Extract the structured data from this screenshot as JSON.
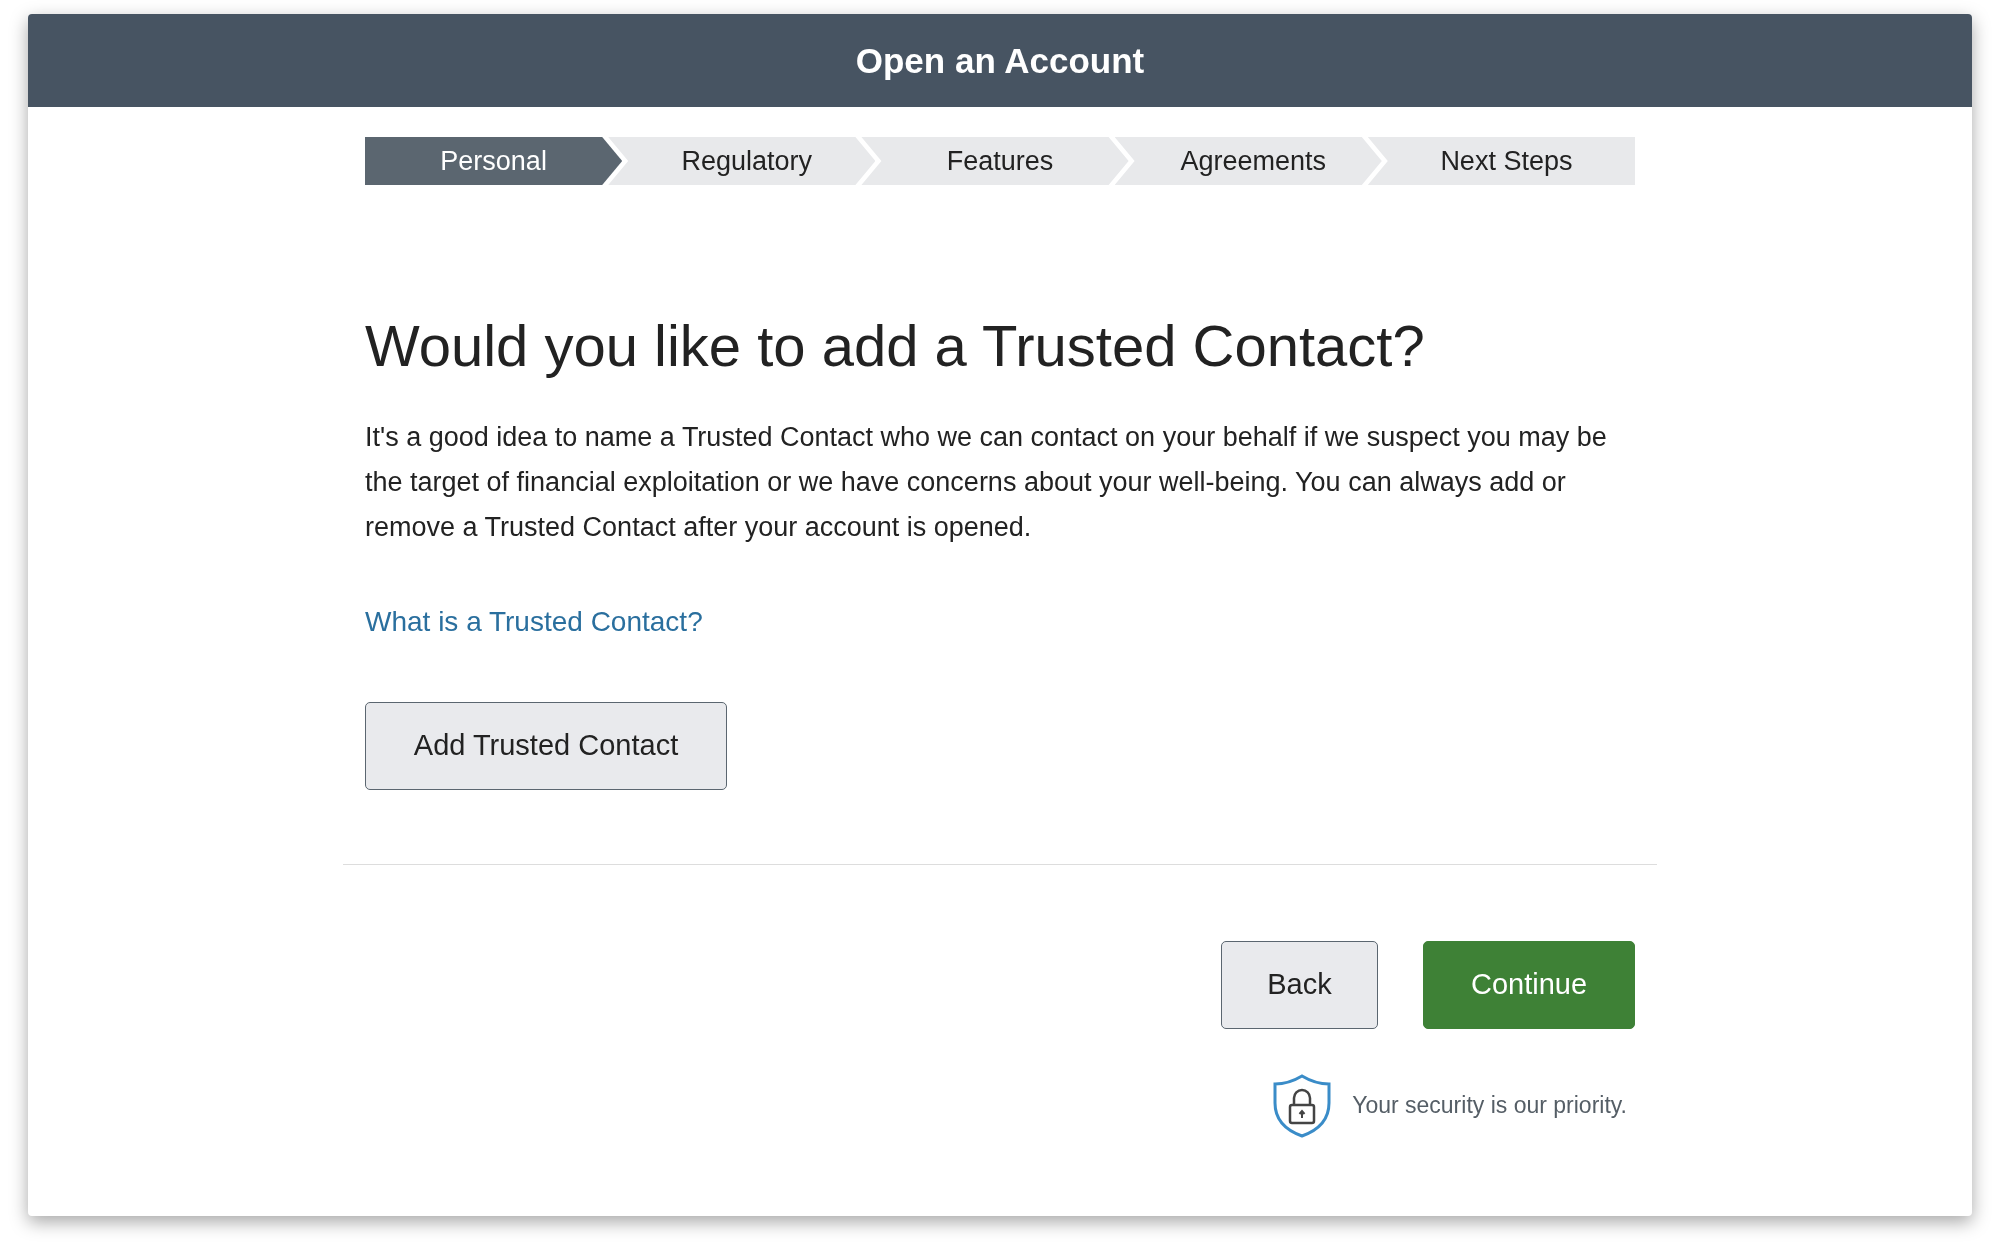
{
  "window": {
    "title": "Open an Account"
  },
  "steps": [
    {
      "label": "Personal",
      "selected": true
    },
    {
      "label": "Regulatory",
      "selected": false
    },
    {
      "label": "Features",
      "selected": false
    },
    {
      "label": "Agreements",
      "selected": false
    },
    {
      "label": "Next Steps",
      "selected": false
    }
  ],
  "heading": "Would you like to add a Trusted Contact?",
  "body": "It's a good idea to name a Trusted Contact who we can contact on your behalf if we suspect you may be the target of financial exploitation or we have concerns about your well-being. You can always add or remove a Trusted Contact after your account is opened.",
  "link": "What is a Trusted Contact?",
  "add_button": "Add Trusted Contact",
  "buttons": [
    {
      "label": "Back",
      "kind": "secondary"
    },
    {
      "label": "Continue",
      "kind": "primary"
    }
  ],
  "security_note": "Your security is our priority."
}
